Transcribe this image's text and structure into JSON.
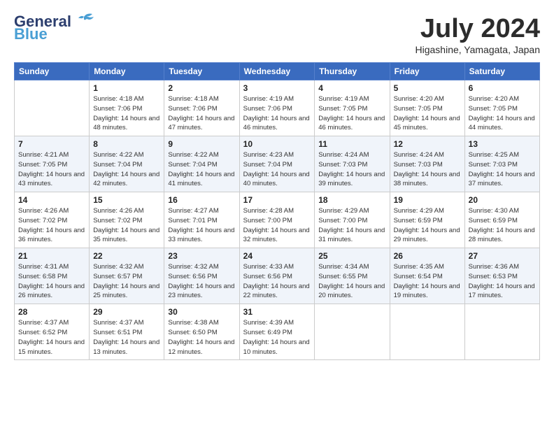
{
  "header": {
    "logo_general": "General",
    "logo_blue": "Blue",
    "month_year": "July 2024",
    "location": "Higashine, Yamagata, Japan"
  },
  "days_of_week": [
    "Sunday",
    "Monday",
    "Tuesday",
    "Wednesday",
    "Thursday",
    "Friday",
    "Saturday"
  ],
  "weeks": [
    [
      {
        "day": "",
        "sunrise": "",
        "sunset": "",
        "daylight": ""
      },
      {
        "day": "1",
        "sunrise": "Sunrise: 4:18 AM",
        "sunset": "Sunset: 7:06 PM",
        "daylight": "Daylight: 14 hours and 48 minutes."
      },
      {
        "day": "2",
        "sunrise": "Sunrise: 4:18 AM",
        "sunset": "Sunset: 7:06 PM",
        "daylight": "Daylight: 14 hours and 47 minutes."
      },
      {
        "day": "3",
        "sunrise": "Sunrise: 4:19 AM",
        "sunset": "Sunset: 7:06 PM",
        "daylight": "Daylight: 14 hours and 46 minutes."
      },
      {
        "day": "4",
        "sunrise": "Sunrise: 4:19 AM",
        "sunset": "Sunset: 7:05 PM",
        "daylight": "Daylight: 14 hours and 46 minutes."
      },
      {
        "day": "5",
        "sunrise": "Sunrise: 4:20 AM",
        "sunset": "Sunset: 7:05 PM",
        "daylight": "Daylight: 14 hours and 45 minutes."
      },
      {
        "day": "6",
        "sunrise": "Sunrise: 4:20 AM",
        "sunset": "Sunset: 7:05 PM",
        "daylight": "Daylight: 14 hours and 44 minutes."
      }
    ],
    [
      {
        "day": "7",
        "sunrise": "Sunrise: 4:21 AM",
        "sunset": "Sunset: 7:05 PM",
        "daylight": "Daylight: 14 hours and 43 minutes."
      },
      {
        "day": "8",
        "sunrise": "Sunrise: 4:22 AM",
        "sunset": "Sunset: 7:04 PM",
        "daylight": "Daylight: 14 hours and 42 minutes."
      },
      {
        "day": "9",
        "sunrise": "Sunrise: 4:22 AM",
        "sunset": "Sunset: 7:04 PM",
        "daylight": "Daylight: 14 hours and 41 minutes."
      },
      {
        "day": "10",
        "sunrise": "Sunrise: 4:23 AM",
        "sunset": "Sunset: 7:04 PM",
        "daylight": "Daylight: 14 hours and 40 minutes."
      },
      {
        "day": "11",
        "sunrise": "Sunrise: 4:24 AM",
        "sunset": "Sunset: 7:03 PM",
        "daylight": "Daylight: 14 hours and 39 minutes."
      },
      {
        "day": "12",
        "sunrise": "Sunrise: 4:24 AM",
        "sunset": "Sunset: 7:03 PM",
        "daylight": "Daylight: 14 hours and 38 minutes."
      },
      {
        "day": "13",
        "sunrise": "Sunrise: 4:25 AM",
        "sunset": "Sunset: 7:03 PM",
        "daylight": "Daylight: 14 hours and 37 minutes."
      }
    ],
    [
      {
        "day": "14",
        "sunrise": "Sunrise: 4:26 AM",
        "sunset": "Sunset: 7:02 PM",
        "daylight": "Daylight: 14 hours and 36 minutes."
      },
      {
        "day": "15",
        "sunrise": "Sunrise: 4:26 AM",
        "sunset": "Sunset: 7:02 PM",
        "daylight": "Daylight: 14 hours and 35 minutes."
      },
      {
        "day": "16",
        "sunrise": "Sunrise: 4:27 AM",
        "sunset": "Sunset: 7:01 PM",
        "daylight": "Daylight: 14 hours and 33 minutes."
      },
      {
        "day": "17",
        "sunrise": "Sunrise: 4:28 AM",
        "sunset": "Sunset: 7:00 PM",
        "daylight": "Daylight: 14 hours and 32 minutes."
      },
      {
        "day": "18",
        "sunrise": "Sunrise: 4:29 AM",
        "sunset": "Sunset: 7:00 PM",
        "daylight": "Daylight: 14 hours and 31 minutes."
      },
      {
        "day": "19",
        "sunrise": "Sunrise: 4:29 AM",
        "sunset": "Sunset: 6:59 PM",
        "daylight": "Daylight: 14 hours and 29 minutes."
      },
      {
        "day": "20",
        "sunrise": "Sunrise: 4:30 AM",
        "sunset": "Sunset: 6:59 PM",
        "daylight": "Daylight: 14 hours and 28 minutes."
      }
    ],
    [
      {
        "day": "21",
        "sunrise": "Sunrise: 4:31 AM",
        "sunset": "Sunset: 6:58 PM",
        "daylight": "Daylight: 14 hours and 26 minutes."
      },
      {
        "day": "22",
        "sunrise": "Sunrise: 4:32 AM",
        "sunset": "Sunset: 6:57 PM",
        "daylight": "Daylight: 14 hours and 25 minutes."
      },
      {
        "day": "23",
        "sunrise": "Sunrise: 4:32 AM",
        "sunset": "Sunset: 6:56 PM",
        "daylight": "Daylight: 14 hours and 23 minutes."
      },
      {
        "day": "24",
        "sunrise": "Sunrise: 4:33 AM",
        "sunset": "Sunset: 6:56 PM",
        "daylight": "Daylight: 14 hours and 22 minutes."
      },
      {
        "day": "25",
        "sunrise": "Sunrise: 4:34 AM",
        "sunset": "Sunset: 6:55 PM",
        "daylight": "Daylight: 14 hours and 20 minutes."
      },
      {
        "day": "26",
        "sunrise": "Sunrise: 4:35 AM",
        "sunset": "Sunset: 6:54 PM",
        "daylight": "Daylight: 14 hours and 19 minutes."
      },
      {
        "day": "27",
        "sunrise": "Sunrise: 4:36 AM",
        "sunset": "Sunset: 6:53 PM",
        "daylight": "Daylight: 14 hours and 17 minutes."
      }
    ],
    [
      {
        "day": "28",
        "sunrise": "Sunrise: 4:37 AM",
        "sunset": "Sunset: 6:52 PM",
        "daylight": "Daylight: 14 hours and 15 minutes."
      },
      {
        "day": "29",
        "sunrise": "Sunrise: 4:37 AM",
        "sunset": "Sunset: 6:51 PM",
        "daylight": "Daylight: 14 hours and 13 minutes."
      },
      {
        "day": "30",
        "sunrise": "Sunrise: 4:38 AM",
        "sunset": "Sunset: 6:50 PM",
        "daylight": "Daylight: 14 hours and 12 minutes."
      },
      {
        "day": "31",
        "sunrise": "Sunrise: 4:39 AM",
        "sunset": "Sunset: 6:49 PM",
        "daylight": "Daylight: 14 hours and 10 minutes."
      },
      {
        "day": "",
        "sunrise": "",
        "sunset": "",
        "daylight": ""
      },
      {
        "day": "",
        "sunrise": "",
        "sunset": "",
        "daylight": ""
      },
      {
        "day": "",
        "sunrise": "",
        "sunset": "",
        "daylight": ""
      }
    ]
  ]
}
